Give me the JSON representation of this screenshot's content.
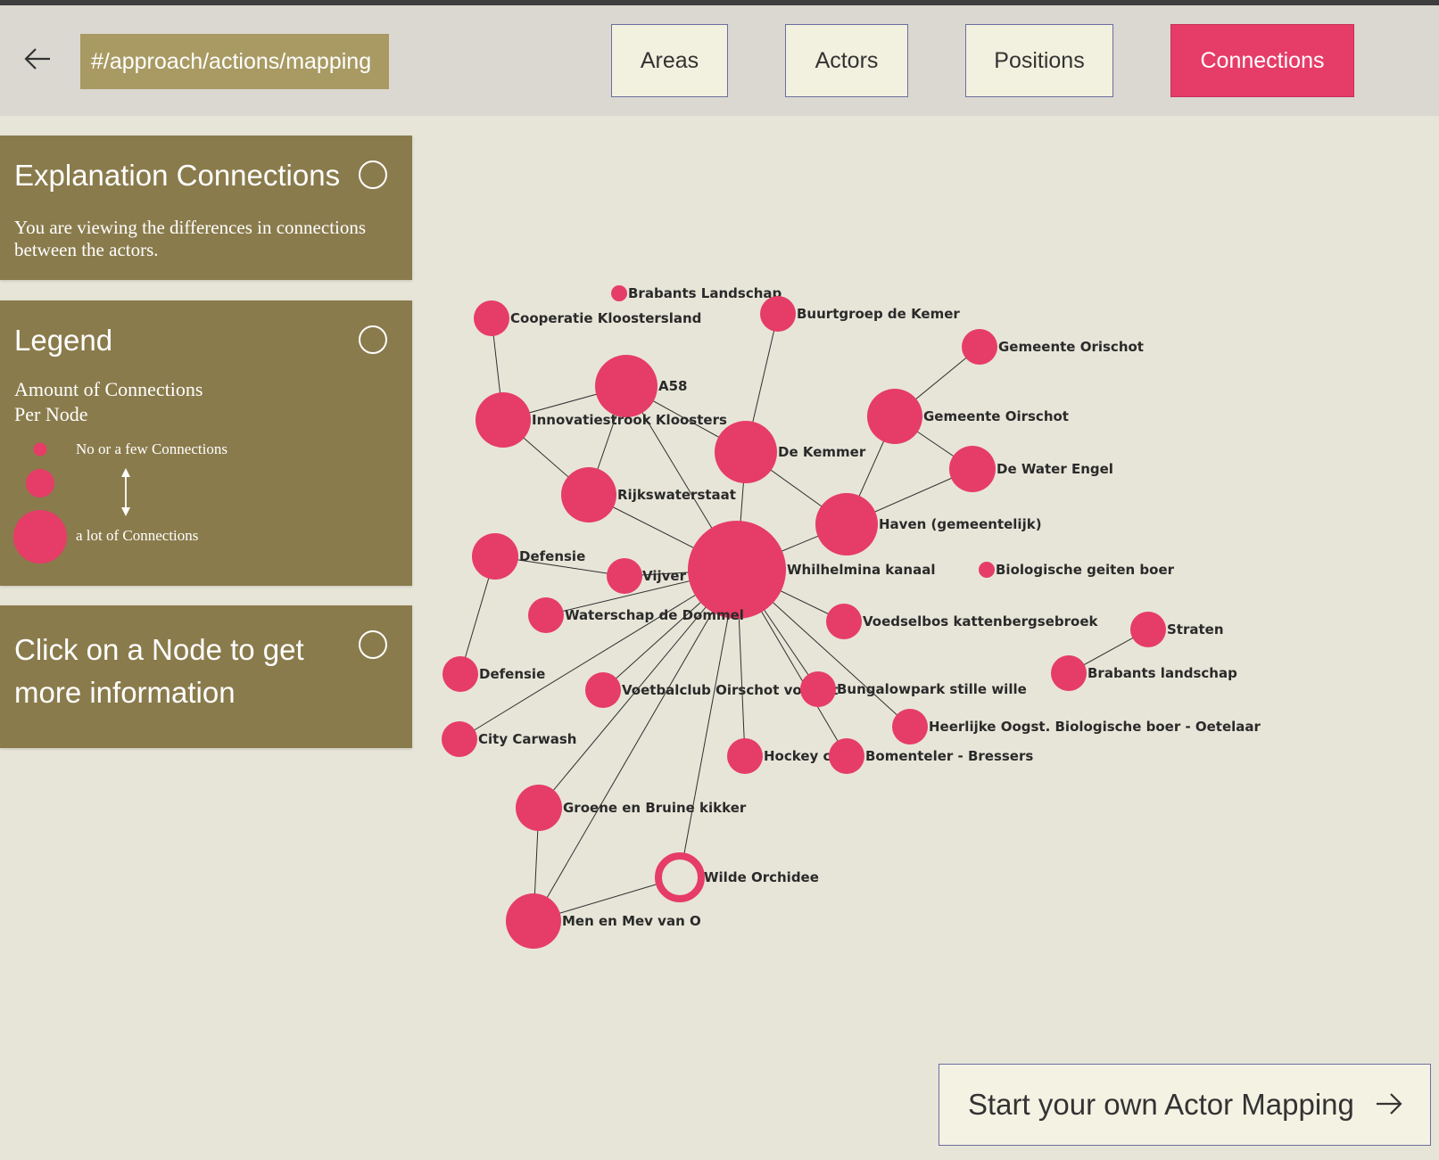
{
  "header": {
    "url": "#/approach/actions/mapping",
    "nav": [
      {
        "label": "Areas",
        "active": false
      },
      {
        "label": "Actors",
        "active": false
      },
      {
        "label": "Positions",
        "active": false
      },
      {
        "label": "Connections",
        "active": true
      }
    ]
  },
  "colors": {
    "accent": "#e63c68",
    "panel": "#8a7b4c",
    "background": "#e7e5d8",
    "url_box": "#a89a62"
  },
  "explanation": {
    "title": "Explanation Connections",
    "text": "You are viewing the differences in connections between the actors."
  },
  "legend": {
    "title": "Legend",
    "subtitle_line1": "Amount of Connections",
    "subtitle_line2": "Per Node",
    "few": "No or a few Connections",
    "many": "a lot of Connections"
  },
  "info": {
    "title_line1": "Click on a Node to get",
    "title_line2": "more information"
  },
  "graph": {
    "nodes": [
      {
        "id": "brabants-landschap-1",
        "label": "Brabants Landschap"
      },
      {
        "id": "cooperatie-kloostersland",
        "label": "Cooperatie Kloostersland"
      },
      {
        "id": "buurtgroep-de-kemer",
        "label": "Buurtgroep de Kemer"
      },
      {
        "id": "gemeente-orischot",
        "label": "Gemeente Orischot"
      },
      {
        "id": "a58",
        "label": "A58"
      },
      {
        "id": "innovatiestrook-kloosters",
        "label": "Innovatiestrook Kloosters"
      },
      {
        "id": "gemeente-oirschot",
        "label": "Gemeente Oirschot"
      },
      {
        "id": "de-kemmer",
        "label": "De Kemmer"
      },
      {
        "id": "de-water-engel",
        "label": "De Water Engel"
      },
      {
        "id": "rijkswaterstaat",
        "label": "Rijkswaterstaat"
      },
      {
        "id": "haven",
        "label": "Haven (gemeentelijk)"
      },
      {
        "id": "defensie-1",
        "label": "Defensie"
      },
      {
        "id": "vijver-winkel",
        "label": "Vijver winkel"
      },
      {
        "id": "whilhelmina-kanaal",
        "label": "Whilhelmina kanaal"
      },
      {
        "id": "biologische-geiten-boer",
        "label": "Biologische geiten boer"
      },
      {
        "id": "waterschap-de-dommel",
        "label": "Waterschap de Dommel"
      },
      {
        "id": "voedselbos",
        "label": "Voedselbos kattenbergsebroek"
      },
      {
        "id": "straten",
        "label": "Straten"
      },
      {
        "id": "defensie-2",
        "label": "Defensie"
      },
      {
        "id": "brabants-landschap-2",
        "label": "Brabants landschap"
      },
      {
        "id": "voetbalclub",
        "label": "Voetbalclub Oirschot vooruit"
      },
      {
        "id": "bungalowpark",
        "label": "Bungalowpark stille wille"
      },
      {
        "id": "heerlijke-oogst",
        "label": "Heerlijke Oogst. Biologische boer - Oetelaar"
      },
      {
        "id": "city-carwash",
        "label": "City Carwash"
      },
      {
        "id": "hockey-club",
        "label": "Hockey club"
      },
      {
        "id": "bomenteler",
        "label": "Bomenteler - Bressers"
      },
      {
        "id": "groene-bruine-kikker",
        "label": "Groene en Bruine kikker"
      },
      {
        "id": "wilde-orchidee",
        "label": "Wilde Orchidee",
        "selected": true
      },
      {
        "id": "men-en-mev",
        "label": "Men en Mev van O"
      }
    ],
    "edges": [
      [
        "cooperatie-kloostersland",
        "innovatiestrook-kloosters"
      ],
      [
        "innovatiestrook-kloosters",
        "a58"
      ],
      [
        "innovatiestrook-kloosters",
        "rijkswaterstaat"
      ],
      [
        "a58",
        "rijkswaterstaat"
      ],
      [
        "a58",
        "whilhelmina-kanaal"
      ],
      [
        "a58",
        "de-kemmer"
      ],
      [
        "buurtgroep-de-kemer",
        "de-kemmer"
      ],
      [
        "de-kemmer",
        "whilhelmina-kanaal"
      ],
      [
        "de-kemmer",
        "haven"
      ],
      [
        "gemeente-orischot",
        "gemeente-oirschot"
      ],
      [
        "gemeente-oirschot",
        "de-water-engel"
      ],
      [
        "gemeente-oirschot",
        "haven"
      ],
      [
        "de-water-engel",
        "haven"
      ],
      [
        "haven",
        "whilhelmina-kanaal"
      ],
      [
        "rijkswaterstaat",
        "whilhelmina-kanaal"
      ],
      [
        "defensie-1",
        "vijver-winkel"
      ],
      [
        "defensie-1",
        "defensie-2"
      ],
      [
        "vijver-winkel",
        "whilhelmina-kanaal"
      ],
      [
        "waterschap-de-dommel",
        "whilhelmina-kanaal"
      ],
      [
        "whilhelmina-kanaal",
        "voedselbos"
      ],
      [
        "whilhelmina-kanaal",
        "city-carwash"
      ],
      [
        "whilhelmina-kanaal",
        "voetbalclub"
      ],
      [
        "whilhelmina-kanaal",
        "bungalowpark"
      ],
      [
        "whilhelmina-kanaal",
        "heerlijke-oogst"
      ],
      [
        "whilhelmina-kanaal",
        "hockey-club"
      ],
      [
        "whilhelmina-kanaal",
        "bomenteler"
      ],
      [
        "whilhelmina-kanaal",
        "groene-bruine-kikker"
      ],
      [
        "whilhelmina-kanaal",
        "men-en-mev"
      ],
      [
        "whilhelmina-kanaal",
        "wilde-orchidee"
      ],
      [
        "groene-bruine-kikker",
        "men-en-mev"
      ],
      [
        "men-en-mev",
        "wilde-orchidee"
      ],
      [
        "straten",
        "brabants-landschap-2"
      ]
    ]
  },
  "start_button": {
    "label": "Start your own Actor Mapping"
  }
}
